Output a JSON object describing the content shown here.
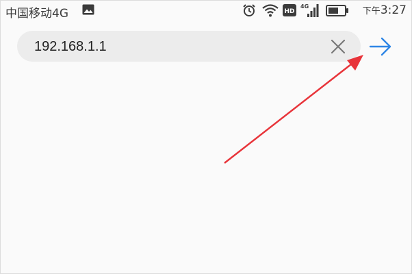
{
  "status_bar": {
    "carrier": "中国移动4G",
    "time_prefix": "下午",
    "time": "3:27",
    "icons": [
      "gallery-icon",
      "alarm-icon",
      "wifi-icon",
      "hd-icon",
      "signal-4g-icon",
      "battery-icon"
    ]
  },
  "address_bar": {
    "value": "192.168.1.1",
    "clear_icon": "close-icon",
    "go_icon": "arrow-right-icon"
  },
  "colors": {
    "accent": "#2f86e6",
    "annotation": "#e8343a",
    "bar_background": "#ececec",
    "page_background": "#fafafa"
  }
}
